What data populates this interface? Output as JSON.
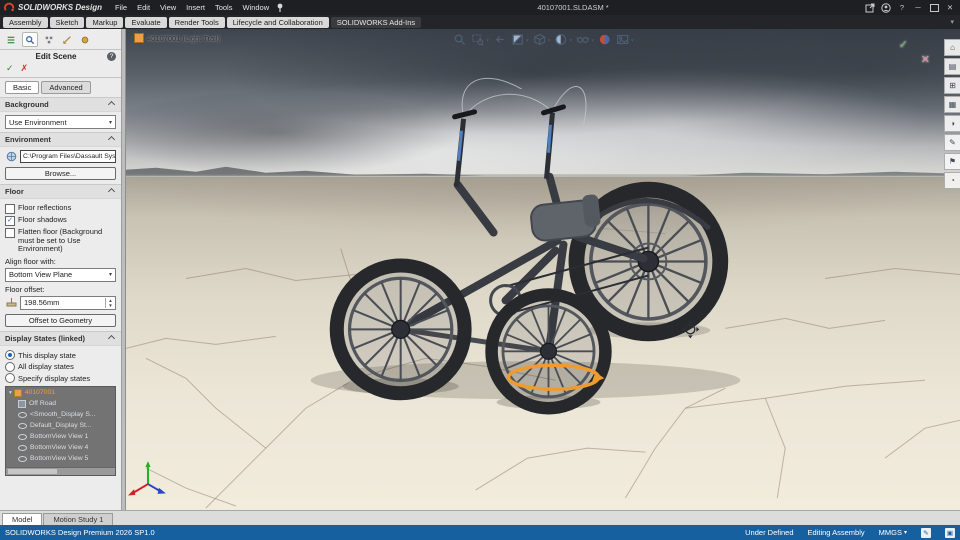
{
  "titlebar": {
    "app_name": "SOLIDWORKS Design",
    "menus": [
      "File",
      "Edit",
      "View",
      "Insert",
      "Tools",
      "Window"
    ],
    "document_title": "40107001.SLDASM *"
  },
  "ribbon_tabs": [
    "Assembly",
    "Sketch",
    "Markup",
    "Evaluate",
    "Render Tools",
    "Lifecycle and Collaboration",
    "SOLIDWORKS Add-Ins"
  ],
  "property_panel": {
    "title": "Edit Scene",
    "mode_tabs": [
      "Basic",
      "Advanced"
    ],
    "background": {
      "header": "Background",
      "value": "Use Environment"
    },
    "environment": {
      "header": "Environment",
      "path": "C:\\Program Files\\Dassault Systeme",
      "browse_label": "Browse..."
    },
    "floor": {
      "header": "Floor",
      "cb_reflections": "Floor reflections",
      "cb_reflections_checked": false,
      "cb_shadows": "Floor shadows",
      "cb_shadows_checked": true,
      "cb_flatten": "Flatten floor (Background must be set to Use Environment)",
      "cb_flatten_checked": false,
      "align_label": "Align floor with:",
      "align_value": "Bottom View Plane",
      "offset_label": "Floor offset:",
      "offset_value": "198.56mm",
      "offset_button": "Offset to Geometry"
    },
    "display_states": {
      "header": "Display States (linked)",
      "r1": "This display state",
      "r2": "All display states",
      "r3": "Specify display states",
      "selected_radio": "This display state",
      "tree": [
        "40107001",
        "Off Road",
        "<Smooth_Display S...",
        "Default_Display St...",
        "BottomView View 1",
        "BottomView View 4",
        "BottomView View 5"
      ]
    }
  },
  "viewport": {
    "breadcrumb": "40107001 (Light Trail)"
  },
  "status": {
    "doc_tabs": [
      "Model",
      "Motion Study 1"
    ],
    "left": "SOLIDWORKS Design Premium 2026 SP1.0",
    "constraint": "Under Defined",
    "mode": "Editing Assembly",
    "units": "MMGS"
  },
  "icons": {
    "titlebar_right": [
      "launch-icon",
      "account-icon",
      "help-icon",
      "minimize-icon",
      "maximize-icon",
      "close-icon"
    ],
    "headsup": [
      "zoom-fit",
      "zoom-to-area",
      "previous-view",
      "section-view",
      "view-orientation",
      "display-style",
      "hide-show-items",
      "edit-appearance",
      "view-settings"
    ],
    "taskpane": [
      "home",
      "design-library",
      "file-explorer",
      "view-palette",
      "appearances-scenes",
      "custom-properties",
      "forum",
      "resources"
    ],
    "pm_tabs": [
      "featuremanager",
      "propertymanager",
      "configurationmanager",
      "dimxpertmanager",
      "displaymanager"
    ]
  },
  "colors": {
    "accent_orange": "#ef9b2d",
    "check_green": "#2e8b2e",
    "cancel_red": "#c0392b",
    "statusbar_blue": "#17609f",
    "selection_blue": "#1565c0"
  }
}
